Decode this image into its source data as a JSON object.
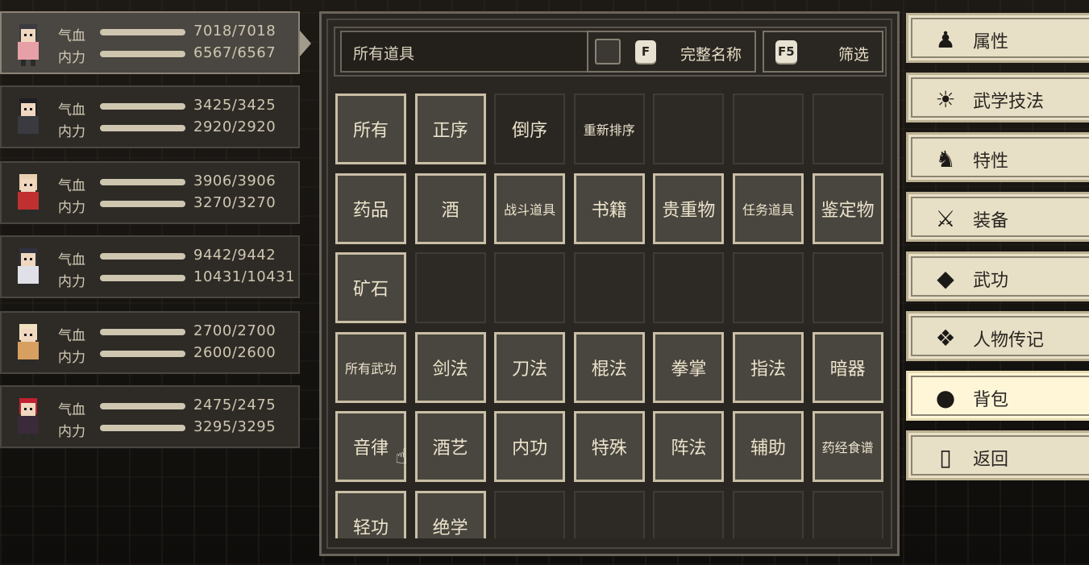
{
  "party": [
    {
      "hp_label": "气血",
      "hp_text": "7018/7018",
      "hp_fill": 1.0,
      "mp_label": "内力",
      "mp_text": "6567/6567",
      "mp_fill": 1.0,
      "selected": true
    },
    {
      "hp_label": "气血",
      "hp_text": "3425/3425",
      "hp_fill": 1.0,
      "mp_label": "内力",
      "mp_text": "2920/2920",
      "mp_fill": 1.0
    },
    {
      "hp_label": "气血",
      "hp_text": "3906/3906",
      "hp_fill": 1.0,
      "mp_label": "内力",
      "mp_text": "3270/3270",
      "mp_fill": 1.0
    },
    {
      "hp_label": "气血",
      "hp_text": "9442/9442",
      "hp_fill": 1.0,
      "mp_label": "内力",
      "mp_text": "10431/10431",
      "mp_fill": 1.0
    },
    {
      "hp_label": "气血",
      "hp_text": "2700/2700",
      "hp_fill": 1.0,
      "mp_label": "内力",
      "mp_text": "2600/2600",
      "mp_fill": 1.0
    },
    {
      "hp_label": "气血",
      "hp_text": "2475/2475",
      "hp_fill": 1.0,
      "mp_label": "内力",
      "mp_text": "3295/3295",
      "mp_fill": 1.0
    }
  ],
  "search": {
    "value": "所有道具"
  },
  "toggle": {
    "key": "F",
    "label": "完整名称"
  },
  "filter": {
    "key": "F5",
    "label": "筛选"
  },
  "grid": [
    [
      "所有",
      "正序",
      "倒序",
      "重新排序",
      "",
      "",
      ""
    ],
    [
      "药品",
      "酒",
      "战斗道具",
      "书籍",
      "贵重物",
      "任务道具",
      "鉴定物"
    ],
    [
      "矿石",
      "",
      "",
      "",
      "",
      "",
      ""
    ],
    [
      "所有武功",
      "剑法",
      "刀法",
      "棍法",
      "拳掌",
      "指法",
      "暗器"
    ],
    [
      "音律",
      "酒艺",
      "内功",
      "特殊",
      "阵法",
      "辅助",
      "药经食谱"
    ],
    [
      "轻功",
      "绝学",
      "",
      "",
      "",
      "",
      ""
    ]
  ],
  "menu": [
    {
      "label": "属性",
      "icon": "person-icon"
    },
    {
      "label": "武学技法",
      "icon": "martial-skill-icon"
    },
    {
      "label": "特性",
      "icon": "trait-icon"
    },
    {
      "label": "装备",
      "icon": "sword-icon"
    },
    {
      "label": "武功",
      "icon": "book-icon"
    },
    {
      "label": "人物传记",
      "icon": "scroll-icon"
    },
    {
      "label": "背包",
      "icon": "bag-icon",
      "active": true
    },
    {
      "label": "返回",
      "icon": "door-icon"
    }
  ]
}
